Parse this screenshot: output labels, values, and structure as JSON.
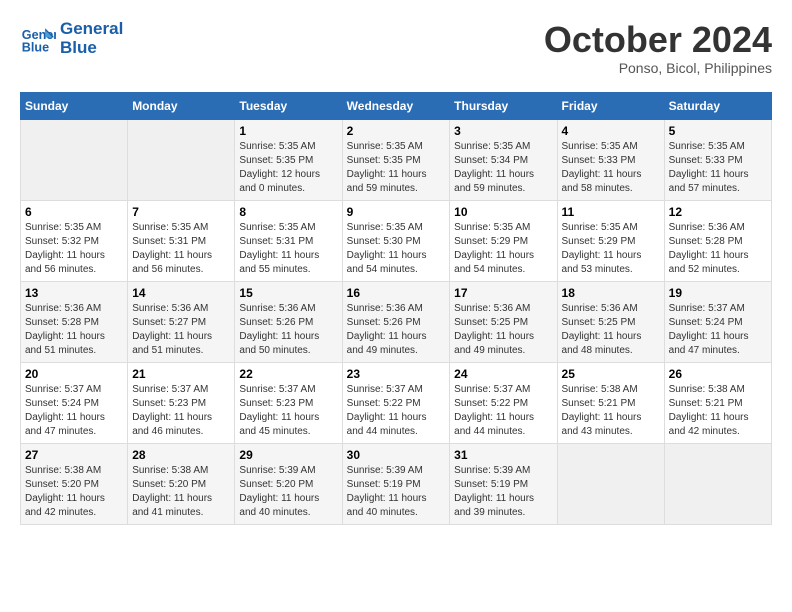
{
  "header": {
    "logo_line1": "General",
    "logo_line2": "Blue",
    "month": "October 2024",
    "location": "Ponso, Bicol, Philippines"
  },
  "days_of_week": [
    "Sunday",
    "Monday",
    "Tuesday",
    "Wednesday",
    "Thursday",
    "Friday",
    "Saturday"
  ],
  "weeks": [
    [
      {
        "day": "",
        "sunrise": "",
        "sunset": "",
        "daylight": ""
      },
      {
        "day": "",
        "sunrise": "",
        "sunset": "",
        "daylight": ""
      },
      {
        "day": "1",
        "sunrise": "Sunrise: 5:35 AM",
        "sunset": "Sunset: 5:35 PM",
        "daylight": "Daylight: 12 hours and 0 minutes."
      },
      {
        "day": "2",
        "sunrise": "Sunrise: 5:35 AM",
        "sunset": "Sunset: 5:35 PM",
        "daylight": "Daylight: 11 hours and 59 minutes."
      },
      {
        "day": "3",
        "sunrise": "Sunrise: 5:35 AM",
        "sunset": "Sunset: 5:34 PM",
        "daylight": "Daylight: 11 hours and 59 minutes."
      },
      {
        "day": "4",
        "sunrise": "Sunrise: 5:35 AM",
        "sunset": "Sunset: 5:33 PM",
        "daylight": "Daylight: 11 hours and 58 minutes."
      },
      {
        "day": "5",
        "sunrise": "Sunrise: 5:35 AM",
        "sunset": "Sunset: 5:33 PM",
        "daylight": "Daylight: 11 hours and 57 minutes."
      }
    ],
    [
      {
        "day": "6",
        "sunrise": "Sunrise: 5:35 AM",
        "sunset": "Sunset: 5:32 PM",
        "daylight": "Daylight: 11 hours and 56 minutes."
      },
      {
        "day": "7",
        "sunrise": "Sunrise: 5:35 AM",
        "sunset": "Sunset: 5:31 PM",
        "daylight": "Daylight: 11 hours and 56 minutes."
      },
      {
        "day": "8",
        "sunrise": "Sunrise: 5:35 AM",
        "sunset": "Sunset: 5:31 PM",
        "daylight": "Daylight: 11 hours and 55 minutes."
      },
      {
        "day": "9",
        "sunrise": "Sunrise: 5:35 AM",
        "sunset": "Sunset: 5:30 PM",
        "daylight": "Daylight: 11 hours and 54 minutes."
      },
      {
        "day": "10",
        "sunrise": "Sunrise: 5:35 AM",
        "sunset": "Sunset: 5:29 PM",
        "daylight": "Daylight: 11 hours and 54 minutes."
      },
      {
        "day": "11",
        "sunrise": "Sunrise: 5:35 AM",
        "sunset": "Sunset: 5:29 PM",
        "daylight": "Daylight: 11 hours and 53 minutes."
      },
      {
        "day": "12",
        "sunrise": "Sunrise: 5:36 AM",
        "sunset": "Sunset: 5:28 PM",
        "daylight": "Daylight: 11 hours and 52 minutes."
      }
    ],
    [
      {
        "day": "13",
        "sunrise": "Sunrise: 5:36 AM",
        "sunset": "Sunset: 5:28 PM",
        "daylight": "Daylight: 11 hours and 51 minutes."
      },
      {
        "day": "14",
        "sunrise": "Sunrise: 5:36 AM",
        "sunset": "Sunset: 5:27 PM",
        "daylight": "Daylight: 11 hours and 51 minutes."
      },
      {
        "day": "15",
        "sunrise": "Sunrise: 5:36 AM",
        "sunset": "Sunset: 5:26 PM",
        "daylight": "Daylight: 11 hours and 50 minutes."
      },
      {
        "day": "16",
        "sunrise": "Sunrise: 5:36 AM",
        "sunset": "Sunset: 5:26 PM",
        "daylight": "Daylight: 11 hours and 49 minutes."
      },
      {
        "day": "17",
        "sunrise": "Sunrise: 5:36 AM",
        "sunset": "Sunset: 5:25 PM",
        "daylight": "Daylight: 11 hours and 49 minutes."
      },
      {
        "day": "18",
        "sunrise": "Sunrise: 5:36 AM",
        "sunset": "Sunset: 5:25 PM",
        "daylight": "Daylight: 11 hours and 48 minutes."
      },
      {
        "day": "19",
        "sunrise": "Sunrise: 5:37 AM",
        "sunset": "Sunset: 5:24 PM",
        "daylight": "Daylight: 11 hours and 47 minutes."
      }
    ],
    [
      {
        "day": "20",
        "sunrise": "Sunrise: 5:37 AM",
        "sunset": "Sunset: 5:24 PM",
        "daylight": "Daylight: 11 hours and 47 minutes."
      },
      {
        "day": "21",
        "sunrise": "Sunrise: 5:37 AM",
        "sunset": "Sunset: 5:23 PM",
        "daylight": "Daylight: 11 hours and 46 minutes."
      },
      {
        "day": "22",
        "sunrise": "Sunrise: 5:37 AM",
        "sunset": "Sunset: 5:23 PM",
        "daylight": "Daylight: 11 hours and 45 minutes."
      },
      {
        "day": "23",
        "sunrise": "Sunrise: 5:37 AM",
        "sunset": "Sunset: 5:22 PM",
        "daylight": "Daylight: 11 hours and 44 minutes."
      },
      {
        "day": "24",
        "sunrise": "Sunrise: 5:37 AM",
        "sunset": "Sunset: 5:22 PM",
        "daylight": "Daylight: 11 hours and 44 minutes."
      },
      {
        "day": "25",
        "sunrise": "Sunrise: 5:38 AM",
        "sunset": "Sunset: 5:21 PM",
        "daylight": "Daylight: 11 hours and 43 minutes."
      },
      {
        "day": "26",
        "sunrise": "Sunrise: 5:38 AM",
        "sunset": "Sunset: 5:21 PM",
        "daylight": "Daylight: 11 hours and 42 minutes."
      }
    ],
    [
      {
        "day": "27",
        "sunrise": "Sunrise: 5:38 AM",
        "sunset": "Sunset: 5:20 PM",
        "daylight": "Daylight: 11 hours and 42 minutes."
      },
      {
        "day": "28",
        "sunrise": "Sunrise: 5:38 AM",
        "sunset": "Sunset: 5:20 PM",
        "daylight": "Daylight: 11 hours and 41 minutes."
      },
      {
        "day": "29",
        "sunrise": "Sunrise: 5:39 AM",
        "sunset": "Sunset: 5:20 PM",
        "daylight": "Daylight: 11 hours and 40 minutes."
      },
      {
        "day": "30",
        "sunrise": "Sunrise: 5:39 AM",
        "sunset": "Sunset: 5:19 PM",
        "daylight": "Daylight: 11 hours and 40 minutes."
      },
      {
        "day": "31",
        "sunrise": "Sunrise: 5:39 AM",
        "sunset": "Sunset: 5:19 PM",
        "daylight": "Daylight: 11 hours and 39 minutes."
      },
      {
        "day": "",
        "sunrise": "",
        "sunset": "",
        "daylight": ""
      },
      {
        "day": "",
        "sunrise": "",
        "sunset": "",
        "daylight": ""
      }
    ]
  ]
}
